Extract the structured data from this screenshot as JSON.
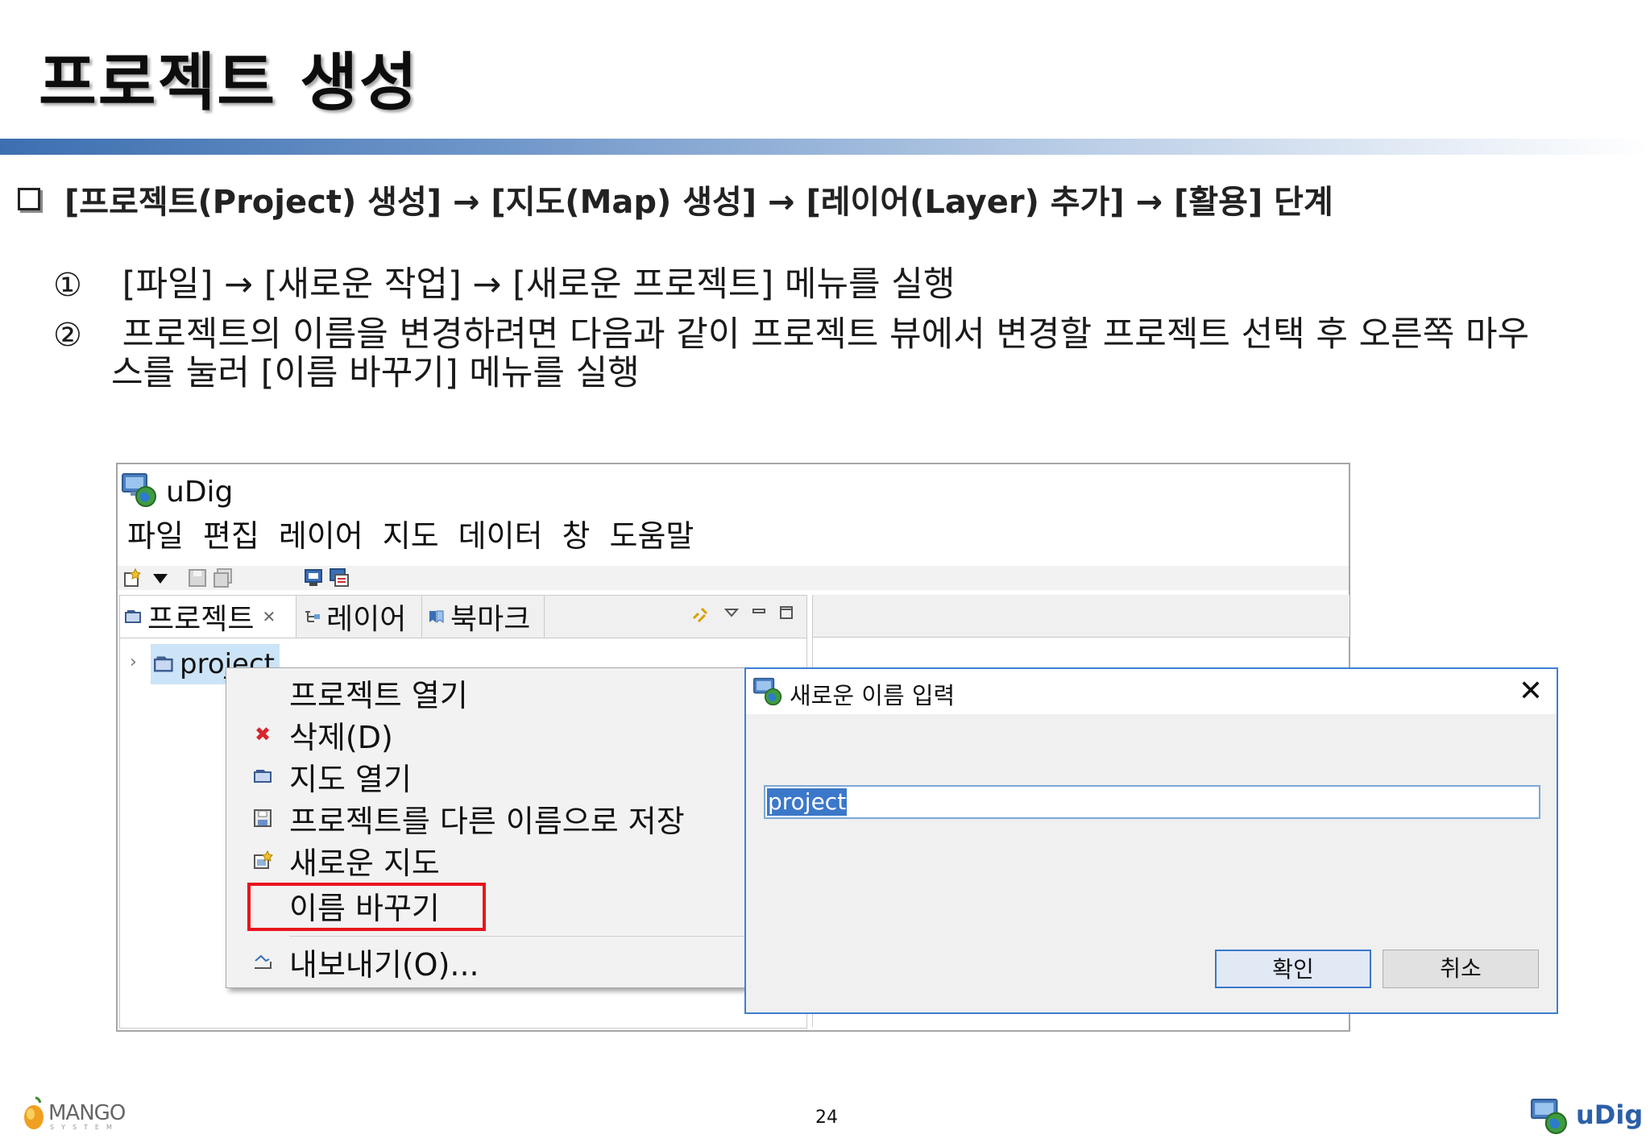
{
  "slide": {
    "title": "프로젝트 생성",
    "steps_line": "[프로젝트(Project) 생성] → [지도(Map) 생성] → [레이어(Layer) 추가] → [활용] 단계",
    "items": [
      {
        "num": "①",
        "text": "[파일] → [새로운 작업] → [새로운 프로젝트] 메뉴를 실행"
      },
      {
        "num": "②",
        "text": "프로젝트의 이름을 변경하려면 다음과 같이 프로젝트 뷰에서 변경할 프로젝트 선택 후 오른쪽 마우",
        "text_cont": "스를 눌러 [이름 바꾸기] 메뉴를 실행"
      }
    ],
    "page_number": "24"
  },
  "app": {
    "title": "uDig",
    "menu": [
      "파일",
      "편집",
      "레이어",
      "지도",
      "데이터",
      "창",
      "도움말"
    ],
    "tabs": [
      {
        "label": "프로젝트",
        "icon": "project-icon",
        "active": true,
        "close": "✕"
      },
      {
        "label": "레이어",
        "icon": "layer-icon"
      },
      {
        "label": "북마크",
        "icon": "bookmark-icon"
      }
    ],
    "tree_node": "project"
  },
  "context_menu": {
    "items": [
      {
        "label": "프로젝트 열기",
        "icon": ""
      },
      {
        "label": "삭제(D)",
        "icon": "delete-icon",
        "glyph": "✖"
      },
      {
        "label": "지도 열기",
        "icon": "open-map-icon"
      },
      {
        "label": "프로젝트를 다른 이름으로 저장",
        "icon": "save-as-icon"
      },
      {
        "label": "새로운 지도",
        "icon": "new-map-icon"
      },
      {
        "label": "이름 바꾸기",
        "icon": "",
        "highlighted": true
      },
      {
        "label": "내보내기(O)...",
        "icon": "export-icon"
      }
    ]
  },
  "dialog": {
    "title": "새로운 이름 입력",
    "close": "✕",
    "input_value": "project",
    "ok_label": "확인",
    "cancel_label": "취소"
  },
  "footer": {
    "left_logo": "MANGO",
    "left_logo_sub": "SYSTEM",
    "right_logo": "uDig"
  },
  "colors": {
    "highlight_box": "#e8151e",
    "selection": "#3b78c9",
    "title_rule": "#3d6fb0",
    "dialog_border": "#3e7fd4"
  }
}
